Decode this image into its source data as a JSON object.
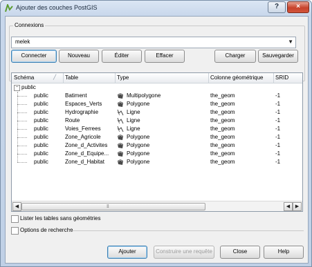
{
  "window": {
    "title": "Ajouter des couches PostGIS",
    "help_label": "?",
    "close_label": "×"
  },
  "connections": {
    "group_label": "Connexions",
    "selected": "melek",
    "buttons": {
      "connect": "Connecter",
      "new": "Nouveau",
      "edit": "Éditer",
      "delete": "Effacer",
      "load": "Charger",
      "save": "Sauvegarder"
    }
  },
  "table": {
    "columns": [
      "Schéma",
      "Table",
      "Type",
      "Colonne géométrique",
      "SRID"
    ],
    "root": "public",
    "rows": [
      {
        "schema": "public",
        "table": "Batiment",
        "type": "Multipolygone",
        "type_icon": "polygon-icon",
        "geom": "the_geom",
        "srid": "-1"
      },
      {
        "schema": "public",
        "table": "Espaces_Verts",
        "type": "Polygone",
        "type_icon": "polygon-icon",
        "geom": "the_geom",
        "srid": "-1"
      },
      {
        "schema": "public",
        "table": "Hydrographie",
        "type": "Ligne",
        "type_icon": "line-icon",
        "geom": "the_geom",
        "srid": "-1"
      },
      {
        "schema": "public",
        "table": "Route",
        "type": "Ligne",
        "type_icon": "line-icon",
        "geom": "the_geom",
        "srid": "-1"
      },
      {
        "schema": "public",
        "table": "Voies_Ferrees",
        "type": "Ligne",
        "type_icon": "line-icon",
        "geom": "the_geom",
        "srid": "-1"
      },
      {
        "schema": "public",
        "table": "Zone_Agricole",
        "type": "Polygone",
        "type_icon": "polygon-icon",
        "geom": "the_geom",
        "srid": "-1"
      },
      {
        "schema": "public",
        "table": "Zone_d_Activites",
        "type": "Polygone",
        "type_icon": "polygon-icon",
        "geom": "the_geom",
        "srid": "-1"
      },
      {
        "schema": "public",
        "table": "Zone_d_Equipe...",
        "type": "Polygone",
        "type_icon": "polygon-icon",
        "geom": "the_geom",
        "srid": "-1"
      },
      {
        "schema": "public",
        "table": "Zone_d_Habitat",
        "type": "Polygone",
        "type_icon": "polygon-icon",
        "geom": "the_geom",
        "srid": "-1"
      }
    ]
  },
  "options": {
    "list_without_geom": "Lister les tables sans géométries",
    "search_options": "Options de recherche"
  },
  "footer": {
    "add": "Ajouter",
    "build_query": "Construire une requête",
    "close": "Close",
    "help": "Help"
  }
}
